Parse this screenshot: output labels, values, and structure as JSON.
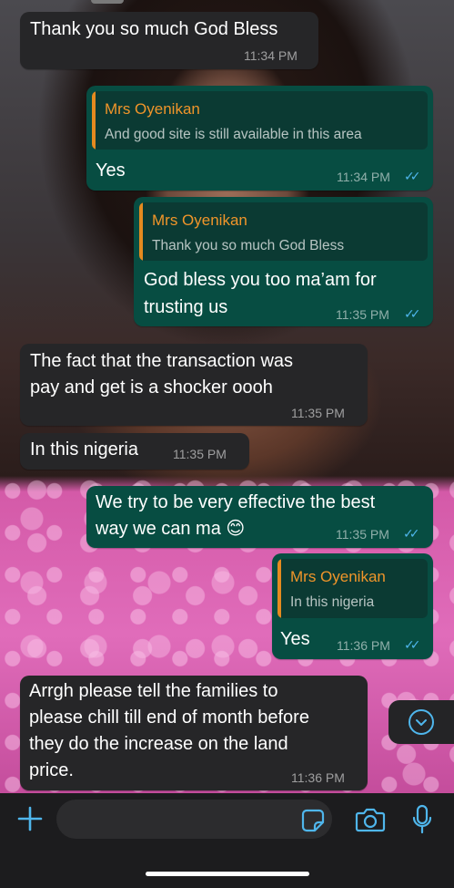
{
  "messages": [
    {
      "direction": "in",
      "text": "Thank you so much God Bless",
      "time": "11:34 PM"
    },
    {
      "direction": "out",
      "quote": {
        "name": "Mrs Oyenikan",
        "text": "And good site is still available in this area"
      },
      "text": "Yes",
      "time": "11:34 PM"
    },
    {
      "direction": "out",
      "quote": {
        "name": "Mrs Oyenikan",
        "text": "Thank you so much God Bless"
      },
      "lines": [
        "God bless you too ma’am for",
        "trusting us"
      ],
      "time": "11:35 PM"
    },
    {
      "direction": "in",
      "lines": [
        "The fact that the transaction was",
        "pay and get is a shocker oooh"
      ],
      "time": "11:35 PM"
    },
    {
      "direction": "in",
      "text": "In this nigeria",
      "time": "11:35 PM"
    },
    {
      "direction": "out",
      "lines": [
        "We try to be very effective the best",
        "way we can ma 😊"
      ],
      "time": "11:35 PM"
    },
    {
      "direction": "out",
      "quote": {
        "name": "Mrs Oyenikan",
        "text": "In this nigeria"
      },
      "text": "Yes",
      "time": "11:36 PM"
    },
    {
      "direction": "in",
      "lines": [
        "Arrgh please tell the families to",
        "please chill till end of month before",
        "they do the increase on the land",
        "price."
      ],
      "time": "11:36 PM"
    }
  ],
  "colors": {
    "incoming": "#262628",
    "outgoing": "#074d42",
    "accent": "#4fb6ec",
    "quote_name": "#f0952a"
  },
  "input_bar": {
    "icons": [
      "plus-icon",
      "sticker-icon",
      "camera-icon",
      "microphone-icon"
    ]
  }
}
